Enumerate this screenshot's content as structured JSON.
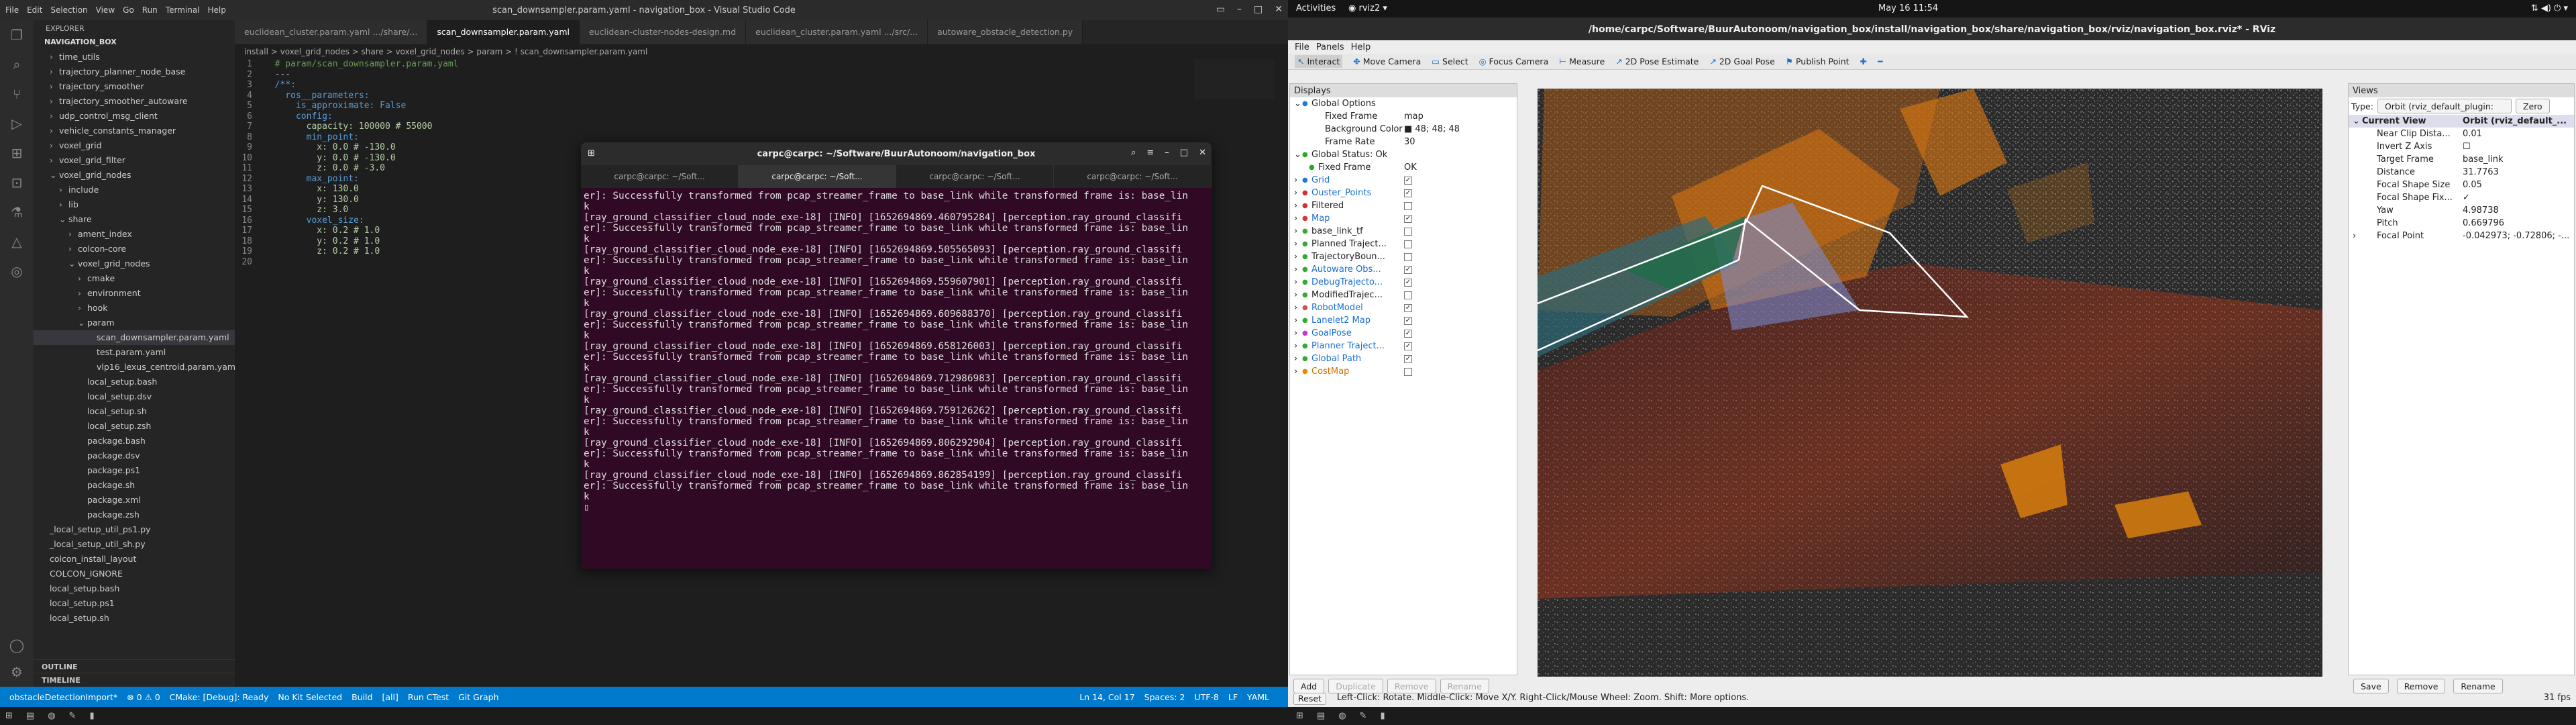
{
  "top_bar": {
    "activities": "Activities",
    "app": "rviz2",
    "clock": "May 16  11:54"
  },
  "vscode": {
    "title": "scan_downsampler.param.yaml - navigation_box - Visual Studio Code",
    "menu": [
      "File",
      "Edit",
      "Selection",
      "View",
      "Go",
      "Run",
      "Terminal",
      "Help"
    ],
    "explorer_header": "EXPLORER",
    "project": "NAVIGATION_BOX",
    "tree": [
      {
        "label": "time_utils",
        "indent": 1,
        "arrow": ">"
      },
      {
        "label": "trajectory_planner_node_base",
        "indent": 1,
        "arrow": ">"
      },
      {
        "label": "trajectory_smoother",
        "indent": 1,
        "arrow": ">"
      },
      {
        "label": "trajectory_smoother_autoware",
        "indent": 1,
        "arrow": ">"
      },
      {
        "label": "udp_control_msg_client",
        "indent": 1,
        "arrow": ">"
      },
      {
        "label": "vehicle_constants_manager",
        "indent": 1,
        "arrow": ">"
      },
      {
        "label": "voxel_grid",
        "indent": 1,
        "arrow": ">"
      },
      {
        "label": "voxel_grid_filter",
        "indent": 1,
        "arrow": ">"
      },
      {
        "label": "voxel_grid_nodes",
        "indent": 1,
        "arrow": "v"
      },
      {
        "label": "include",
        "indent": 2,
        "arrow": ">"
      },
      {
        "label": "lib",
        "indent": 2,
        "arrow": ">"
      },
      {
        "label": "share",
        "indent": 2,
        "arrow": "v"
      },
      {
        "label": "ament_index",
        "indent": 3,
        "arrow": ">"
      },
      {
        "label": "colcon-core",
        "indent": 3,
        "arrow": ">"
      },
      {
        "label": "voxel_grid_nodes",
        "indent": 3,
        "arrow": "v"
      },
      {
        "label": "cmake",
        "indent": 4,
        "arrow": ">"
      },
      {
        "label": "environment",
        "indent": 4,
        "arrow": ">"
      },
      {
        "label": "hook",
        "indent": 4,
        "arrow": ">"
      },
      {
        "label": "param",
        "indent": 4,
        "arrow": "v"
      },
      {
        "label": "scan_downsampler.param.yaml",
        "indent": 5,
        "arrow": "",
        "sel": true
      },
      {
        "label": "test.param.yaml",
        "indent": 5,
        "arrow": ""
      },
      {
        "label": "vlp16_lexus_centroid.param.yaml",
        "indent": 5,
        "arrow": ""
      },
      {
        "label": "local_setup.bash",
        "indent": 4,
        "arrow": ""
      },
      {
        "label": "local_setup.dsv",
        "indent": 4,
        "arrow": ""
      },
      {
        "label": "local_setup.sh",
        "indent": 4,
        "arrow": ""
      },
      {
        "label": "local_setup.zsh",
        "indent": 4,
        "arrow": ""
      },
      {
        "label": "package.bash",
        "indent": 4,
        "arrow": ""
      },
      {
        "label": "package.dsv",
        "indent": 4,
        "arrow": ""
      },
      {
        "label": "package.ps1",
        "indent": 4,
        "arrow": ""
      },
      {
        "label": "package.sh",
        "indent": 4,
        "arrow": ""
      },
      {
        "label": "package.xml",
        "indent": 4,
        "arrow": ""
      },
      {
        "label": "package.zsh",
        "indent": 4,
        "arrow": ""
      },
      {
        "label": "_local_setup_util_ps1.py",
        "indent": 0,
        "arrow": ""
      },
      {
        "label": "_local_setup_util_sh.py",
        "indent": 0,
        "arrow": ""
      },
      {
        "label": "colcon_install_layout",
        "indent": 0,
        "arrow": ""
      },
      {
        "label": "COLCON_IGNORE",
        "indent": 0,
        "arrow": ""
      },
      {
        "label": "local_setup.bash",
        "indent": 0,
        "arrow": ""
      },
      {
        "label": "local_setup.ps1",
        "indent": 0,
        "arrow": ""
      },
      {
        "label": "local_setup.sh",
        "indent": 0,
        "arrow": ""
      }
    ],
    "outline": "OUTLINE",
    "timeline": "TIMELINE",
    "tabs": [
      {
        "label": "euclidean_cluster.param.yaml .../share/...",
        "active": false
      },
      {
        "label": "scan_downsampler.param.yaml",
        "active": true
      },
      {
        "label": "euclidean-cluster-nodes-design.md",
        "active": false
      },
      {
        "label": "euclidean_cluster.param.yaml .../src/...",
        "active": false
      },
      {
        "label": "autoware_obstacle_detection.py",
        "active": false
      }
    ],
    "breadcrumb": "install > voxel_grid_nodes > share > voxel_grid_nodes > param > ! scan_downsampler.param.yaml",
    "code": [
      {
        "n": "1",
        "t": "  # param/scan_downsampler.param.yaml",
        "c": "#6a9955"
      },
      {
        "n": "2",
        "t": "  ---",
        "c": "#ccc"
      },
      {
        "n": "3",
        "t": "  /**:",
        "c": "#569cd6"
      },
      {
        "n": "4",
        "t": "    ros__parameters:",
        "c": "#569cd6"
      },
      {
        "n": "5",
        "t": "      is_approximate: False",
        "c": "#569cd6"
      },
      {
        "n": "6",
        "t": "      config:",
        "c": "#569cd6"
      },
      {
        "n": "7",
        "t": "        capacity: 100000 # 55000",
        "c": "#b5cea8"
      },
      {
        "n": "8",
        "t": "        min_point:",
        "c": "#569cd6"
      },
      {
        "n": "9",
        "t": "          x: 0.0 # -130.0",
        "c": "#b5cea8"
      },
      {
        "n": "10",
        "t": "          y: 0.0 # -130.0",
        "c": "#b5cea8"
      },
      {
        "n": "11",
        "t": "          z: 0.0 # -3.0",
        "c": "#b5cea8"
      },
      {
        "n": "12",
        "t": "        max_point:",
        "c": "#569cd6"
      },
      {
        "n": "13",
        "t": "          x: 130.0",
        "c": "#b5cea8"
      },
      {
        "n": "14",
        "t": "          y: 130.0",
        "c": "#b5cea8"
      },
      {
        "n": "15",
        "t": "          z: 3.0",
        "c": "#b5cea8"
      },
      {
        "n": "16",
        "t": "        voxel_size:",
        "c": "#569cd6"
      },
      {
        "n": "17",
        "t": "          x: 0.2 # 1.0",
        "c": "#b5cea8"
      },
      {
        "n": "18",
        "t": "          y: 0.2 # 1.0",
        "c": "#b5cea8"
      },
      {
        "n": "19",
        "t": "          z: 0.2 # 1.0",
        "c": "#b5cea8"
      },
      {
        "n": "20",
        "t": "",
        "c": "#ccc"
      }
    ],
    "status": [
      "obstacleDetectionImport*",
      "⊗ 0 ⚠ 0",
      "CMake: [Debug]: Ready",
      "No Kit Selected",
      "Build",
      "[all]",
      "Run CTest",
      "Git Graph"
    ],
    "status_right": [
      "Ln 14, Col 17",
      "Spaces: 2",
      "UTF-8",
      "LF",
      "YAML"
    ]
  },
  "terminal": {
    "title": "carpc@carpc: ~/Software/BuurAutonoom/navigation_box",
    "tabs": [
      "carpc@carpc: ~/Soft...",
      "carpc@carpc: ~/Soft...",
      "carpc@carpc: ~/Soft...",
      "carpc@carpc: ~/Soft..."
    ],
    "lines": [
      "er]: Successfully transformed from pcap_streamer_frame to base_link while transformed frame is: base_lin",
      "k",
      "[ray_ground_classifier_cloud_node_exe-18] [INFO] [1652694869.460795284] [perception.ray_ground_classifi",
      "er]: Successfully transformed from pcap_streamer_frame to base_link while transformed frame is: base_lin",
      "k",
      "[ray_ground_classifier_cloud_node_exe-18] [INFO] [1652694869.505565093] [perception.ray_ground_classifi",
      "er]: Successfully transformed from pcap_streamer_frame to base_link while transformed frame is: base_lin",
      "k",
      "[ray_ground_classifier_cloud_node_exe-18] [INFO] [1652694869.559607901] [perception.ray_ground_classifi",
      "er]: Successfully transformed from pcap_streamer_frame to base_link while transformed frame is: base_lin",
      "k",
      "[ray_ground_classifier_cloud_node_exe-18] [INFO] [1652694869.609688370] [perception.ray_ground_classifi",
      "er]: Successfully transformed from pcap_streamer_frame to base_link while transformed frame is: base_lin",
      "k",
      "[ray_ground_classifier_cloud_node_exe-18] [INFO] [1652694869.658126003] [perception.ray_ground_classifi",
      "er]: Successfully transformed from pcap_streamer_frame to base_link while transformed frame is: base_lin",
      "k",
      "[ray_ground_classifier_cloud_node_exe-18] [INFO] [1652694869.712986983] [perception.ray_ground_classifi",
      "er]: Successfully transformed from pcap_streamer_frame to base_link while transformed frame is: base_lin",
      "k",
      "[ray_ground_classifier_cloud_node_exe-18] [INFO] [1652694869.759126262] [perception.ray_ground_classifi",
      "er]: Successfully transformed from pcap_streamer_frame to base_link while transformed frame is: base_lin",
      "k",
      "[ray_ground_classifier_cloud_node_exe-18] [INFO] [1652694869.806292904] [perception.ray_ground_classifi",
      "er]: Successfully transformed from pcap_streamer_frame to base_link while transformed frame is: base_lin",
      "k",
      "[ray_ground_classifier_cloud_node_exe-18] [INFO] [1652694869.862854199] [perception.ray_ground_classifi",
      "er]: Successfully transformed from pcap_streamer_frame to base_link while transformed frame is: base_lin",
      "k"
    ]
  },
  "rviz": {
    "title": "/home/carpc/Software/BuurAutonoom/navigation_box/install/navigation_box/share/navigation_box/rviz/navigation_box.rviz* - RViz",
    "menu": [
      "File",
      "Panels",
      "Help"
    ],
    "tools": [
      "Interact",
      "Move Camera",
      "Select",
      "Focus Camera",
      "Measure",
      "2D Pose Estimate",
      "2D Goal Pose",
      "Publish Point"
    ],
    "displays_title": "Displays",
    "displays": [
      {
        "label": "Global Options",
        "indent": 0,
        "arrow": "v",
        "val": "",
        "check": "",
        "color": "#222",
        "icon": "#1b7bd1"
      },
      {
        "label": "Fixed Frame",
        "indent": 2,
        "arrow": "",
        "val": "map",
        "check": "",
        "color": "#222",
        "icon": ""
      },
      {
        "label": "Background Color",
        "indent": 2,
        "arrow": "",
        "val": "■ 48; 48; 48",
        "check": "",
        "color": "#222",
        "icon": ""
      },
      {
        "label": "Frame Rate",
        "indent": 2,
        "arrow": "",
        "val": "30",
        "check": "",
        "color": "#222",
        "icon": ""
      },
      {
        "label": "Global Status: Ok",
        "indent": 0,
        "arrow": "v",
        "val": "",
        "check": "",
        "color": "#222",
        "icon": "#2a2"
      },
      {
        "label": "Fixed Frame",
        "indent": 1,
        "arrow": "",
        "val": "OK",
        "check": "",
        "color": "#222",
        "icon": "#2a2"
      },
      {
        "label": "Grid",
        "indent": 0,
        "arrow": ">",
        "val": "",
        "check": "✓",
        "color": "#1b6fd1",
        "icon": "#1b7bd1"
      },
      {
        "label": "Ouster_Points",
        "indent": 0,
        "arrow": ">",
        "val": "",
        "check": "✓",
        "color": "#1b6fd1",
        "icon": "#c33"
      },
      {
        "label": "Filtered",
        "indent": 0,
        "arrow": ">",
        "val": "",
        "check": "",
        "color": "#222",
        "icon": "#c33"
      },
      {
        "label": "Map",
        "indent": 0,
        "arrow": ">",
        "val": "",
        "check": "✓",
        "color": "#1b6fd1",
        "icon": "#d33"
      },
      {
        "label": "base_link_tf",
        "indent": 0,
        "arrow": ">",
        "val": "",
        "check": "",
        "color": "#222",
        "icon": "#3a3"
      },
      {
        "label": "Planned Traject...",
        "indent": 0,
        "arrow": ">",
        "val": "",
        "check": "",
        "color": "#222",
        "icon": "#3a3"
      },
      {
        "label": "TrajectoryBoun...",
        "indent": 0,
        "arrow": ">",
        "val": "",
        "check": "",
        "color": "#222",
        "icon": "#3a3"
      },
      {
        "label": "Autoware Obs...",
        "indent": 0,
        "arrow": ">",
        "val": "",
        "check": "✓",
        "color": "#1b6fd1",
        "icon": "#3a3"
      },
      {
        "label": "DebugTrajecto...",
        "indent": 0,
        "arrow": ">",
        "val": "",
        "check": "✓",
        "color": "#1b6fd1",
        "icon": "#3a3"
      },
      {
        "label": "ModifiedTrajec...",
        "indent": 0,
        "arrow": ">",
        "val": "",
        "check": "",
        "color": "#222",
        "icon": "#3a3"
      },
      {
        "label": "RobotModel",
        "indent": 0,
        "arrow": ">",
        "val": "",
        "check": "✓",
        "color": "#1b6fd1",
        "icon": "#c55"
      },
      {
        "label": "Lanelet2 Map",
        "indent": 0,
        "arrow": ">",
        "val": "",
        "check": "✓",
        "color": "#1b6fd1",
        "icon": "#3a3"
      },
      {
        "label": "GoalPose",
        "indent": 0,
        "arrow": ">",
        "val": "",
        "check": "✓",
        "color": "#1b6fd1",
        "icon": "#c3c"
      },
      {
        "label": "Planner Traject...",
        "indent": 0,
        "arrow": ">",
        "val": "",
        "check": "✓",
        "color": "#1b6fd1",
        "icon": "#3a3"
      },
      {
        "label": "Global Path",
        "indent": 0,
        "arrow": ">",
        "val": "",
        "check": "✓",
        "color": "#1b6fd1",
        "icon": "#3a3"
      },
      {
        "label": "CostMap",
        "indent": 0,
        "arrow": ">",
        "val": "",
        "check": "",
        "color": "#d07000",
        "icon": "#e80"
      }
    ],
    "disp_buttons": [
      {
        "label": "Add",
        "dis": false
      },
      {
        "label": "Duplicate",
        "dis": true
      },
      {
        "label": "Remove",
        "dis": true
      },
      {
        "label": "Rename",
        "dis": true
      }
    ],
    "views_title": "Views",
    "views_type_label": "Type:",
    "views_type": "Orbit (rviz_default_plugin:",
    "views_zero": "Zero",
    "views": [
      {
        "k": "Current View",
        "v": "Orbit (rviz_default_...",
        "bold": true,
        "arrow": "v"
      },
      {
        "k": "Near Clip Dista...",
        "v": "0.01",
        "bold": false,
        "arrow": ""
      },
      {
        "k": "Invert Z Axis",
        "v": "☐",
        "bold": false,
        "arrow": ""
      },
      {
        "k": "Target Frame",
        "v": "base_link",
        "bold": false,
        "arrow": ""
      },
      {
        "k": "Distance",
        "v": "31.7763",
        "bold": false,
        "arrow": ""
      },
      {
        "k": "Focal Shape Size",
        "v": "0.05",
        "bold": false,
        "arrow": ""
      },
      {
        "k": "Focal Shape Fix...",
        "v": "✓",
        "bold": false,
        "arrow": ""
      },
      {
        "k": "Yaw",
        "v": "4.98738",
        "bold": false,
        "arrow": ""
      },
      {
        "k": "Pitch",
        "v": "0.669796",
        "bold": false,
        "arrow": ""
      },
      {
        "k": "Focal Point",
        "v": "-0.042973; -0.72806; -...",
        "bold": false,
        "arrow": ">"
      }
    ],
    "views_buttons": [
      "Save",
      "Remove",
      "Rename"
    ],
    "status": {
      "reset": "Reset",
      "hint": "Left-Click: Rotate.  Middle-Click: Move X/Y.  Right-Click/Mouse Wheel: Zoom.  Shift: More options.",
      "fps": "31 fps"
    },
    "colors": {
      "viewport_bg": "#2b2b2b",
      "box": "#e07a10",
      "path": "#7a90d8",
      "lanelet": "#ffffff"
    }
  }
}
